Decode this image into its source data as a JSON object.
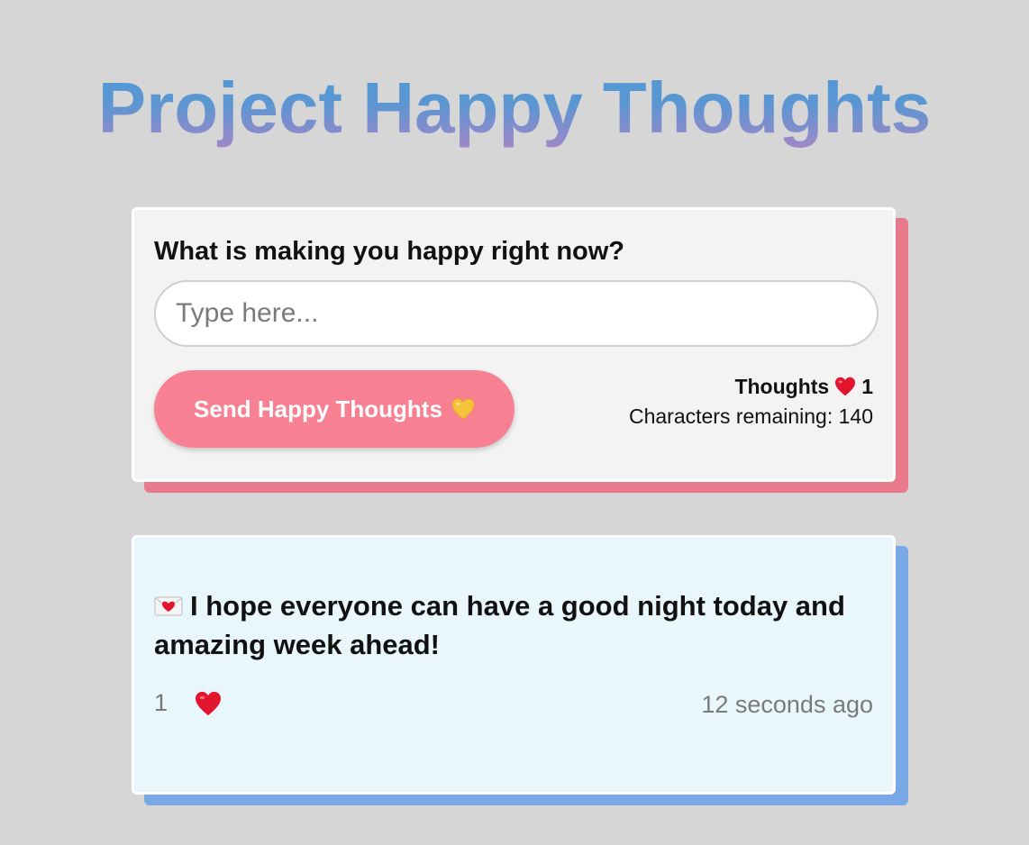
{
  "header": {
    "title": "Project Happy Thoughts"
  },
  "form": {
    "question": "What is making you happy right now?",
    "input_placeholder": "Type here...",
    "input_value": "",
    "send_label": "Send Happy Thoughts",
    "send_icon": "yellow-heart-icon",
    "thoughts_label": "Thoughts",
    "thoughts_icon": "red-heart-icon",
    "thoughts_count": "1",
    "chars_remaining_label": "Characters remaining: 140"
  },
  "thoughts": [
    {
      "icon": "love-letter-icon",
      "message": "I hope everyone can have a good night today and amazing week ahead!",
      "likes": "1",
      "like_icon": "red-heart-icon",
      "time": "12 seconds ago"
    }
  ],
  "colors": {
    "background": "#d6d6d6",
    "title_gradient_top": "#4f9ad6",
    "title_gradient_bottom": "#a586c6",
    "form_card": "#f3f3f3",
    "form_shadow": "#e87a8c",
    "send_button": "#f78193",
    "thought_card": "#e9f7fd",
    "thought_shadow": "#78a8e6"
  }
}
